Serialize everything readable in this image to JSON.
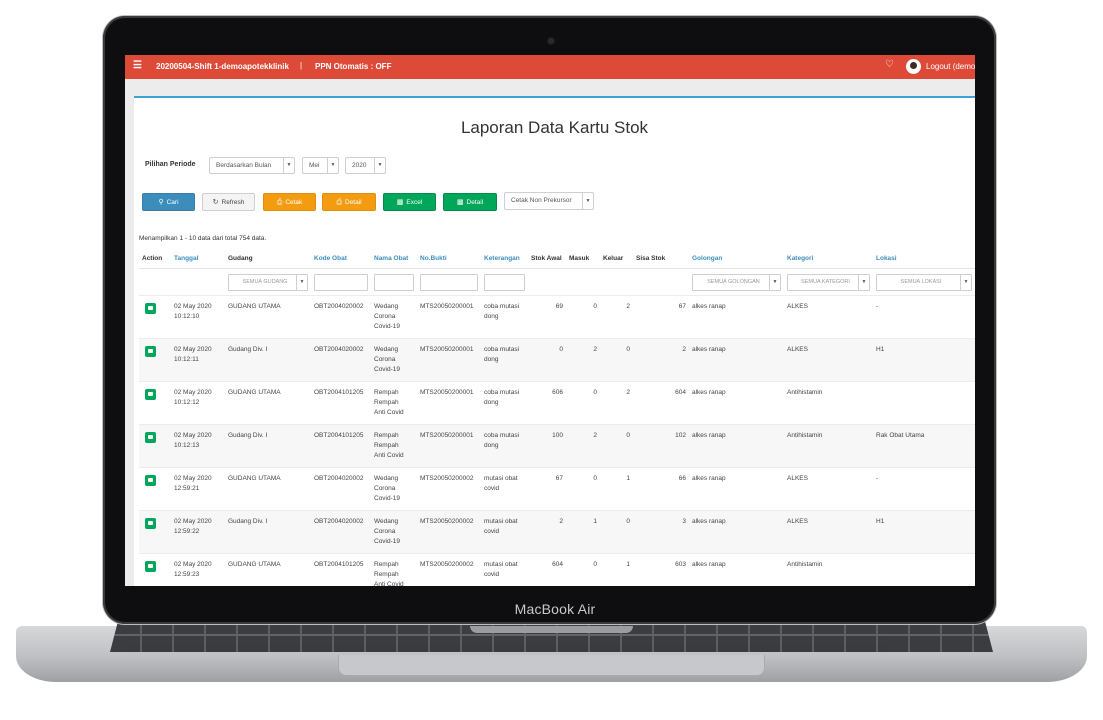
{
  "device": {
    "label": "MacBook Air"
  },
  "topbar": {
    "title": "20200504-Shift 1-demoapotekklinik",
    "separator": "|",
    "ppn": "PPN Otomatis : OFF",
    "logout": "Logout (demoa",
    "color": "#dd4a38"
  },
  "page": {
    "title": "Laporan Data Kartu Stok",
    "periode_label": "Pilihan Periode",
    "periode_mode": "Berdasarkan Bulan",
    "month": "Mei",
    "year": "2020",
    "prekursor": "Cetak Non Prekursor",
    "info": "Menampilkan 1 - 10 data dari total 754 data."
  },
  "buttons": {
    "cari": "Cari",
    "refresh": "Refresh",
    "cetak": "Cetak",
    "detail_print": "Detail",
    "excel": "Excel",
    "detail_excel": "Detail"
  },
  "columns": [
    "Action",
    "Tanggal",
    "Gudang",
    "Kode Obat",
    "Nama Obat",
    "No.Bukti",
    "Keterangan",
    "Stok Awal",
    "Masuk",
    "Keluar",
    "Sisa Stok",
    "Golongan",
    "Kategori",
    "Lokasi"
  ],
  "filters": {
    "gudang": "SEMUA GUDANG",
    "golongan": "SEMUA GOLONGAN",
    "kategori": "SEMUA KATEGORI",
    "lokasi": "SEMUA LOKASI"
  },
  "rows": [
    {
      "tanggal": "02 May 2020\n10:12:10",
      "gudang": "GUDANG UTAMA",
      "kode": "OBT2004020002",
      "nama": "Wedang\nCorona\nCovid-19",
      "bukti": "MTS20050200001",
      "ket": "coba mutasi\ndong",
      "awal": "69",
      "masuk": "0",
      "keluar": "2",
      "sisa": "67",
      "golongan": "alkes ranap",
      "kategori": "ALKES",
      "lokasi": "-"
    },
    {
      "tanggal": "02 May 2020\n10:12:11",
      "gudang": "Gudang Div. I",
      "kode": "OBT2004020002",
      "nama": "Wedang\nCorona\nCovid-19",
      "bukti": "MTS20050200001",
      "ket": "coba mutasi\ndong",
      "awal": "0",
      "masuk": "2",
      "keluar": "0",
      "sisa": "2",
      "golongan": "alkes ranap",
      "kategori": "ALKES",
      "lokasi": "H1"
    },
    {
      "tanggal": "02 May 2020\n10:12:12",
      "gudang": "GUDANG UTAMA",
      "kode": "OBT2004101205",
      "nama": "Rempah\nRempah\nAnti Covid",
      "bukti": "MTS20050200001",
      "ket": "coba mutasi\ndong",
      "awal": "606",
      "masuk": "0",
      "keluar": "2",
      "sisa": "604",
      "golongan": "alkes ranap",
      "kategori": "Antihistamin",
      "lokasi": ""
    },
    {
      "tanggal": "02 May 2020\n10:12:13",
      "gudang": "Gudang Div. I",
      "kode": "OBT2004101205",
      "nama": "Rempah\nRempah\nAnti Covid",
      "bukti": "MTS20050200001",
      "ket": "coba mutasi\ndong",
      "awal": "100",
      "masuk": "2",
      "keluar": "0",
      "sisa": "102",
      "golongan": "alkes ranap",
      "kategori": "Antihistamin",
      "lokasi": "Rak Obat Utama"
    },
    {
      "tanggal": "02 May 2020\n12:59:21",
      "gudang": "GUDANG UTAMA",
      "kode": "OBT2004020002",
      "nama": "Wedang\nCorona\nCovid-19",
      "bukti": "MTS20050200002",
      "ket": "mutasi obat\ncovid",
      "awal": "67",
      "masuk": "0",
      "keluar": "1",
      "sisa": "66",
      "golongan": "alkes ranap",
      "kategori": "ALKES",
      "lokasi": "-"
    },
    {
      "tanggal": "02 May 2020\n12:59:22",
      "gudang": "Gudang Div. I",
      "kode": "OBT2004020002",
      "nama": "Wedang\nCorona\nCovid-19",
      "bukti": "MTS20050200002",
      "ket": "mutasi obat\ncovid",
      "awal": "2",
      "masuk": "1",
      "keluar": "0",
      "sisa": "3",
      "golongan": "alkes ranap",
      "kategori": "ALKES",
      "lokasi": "H1"
    },
    {
      "tanggal": "02 May 2020\n12:59:23",
      "gudang": "GUDANG UTAMA",
      "kode": "OBT2004101205",
      "nama": "Rempah\nRempah\nAnti Covid",
      "bukti": "MTS20050200002",
      "ket": "mutasi obat\ncovid",
      "awal": "604",
      "masuk": "0",
      "keluar": "1",
      "sisa": "603",
      "golongan": "alkes ranap",
      "kategori": "Antihistamin",
      "lokasi": ""
    }
  ]
}
